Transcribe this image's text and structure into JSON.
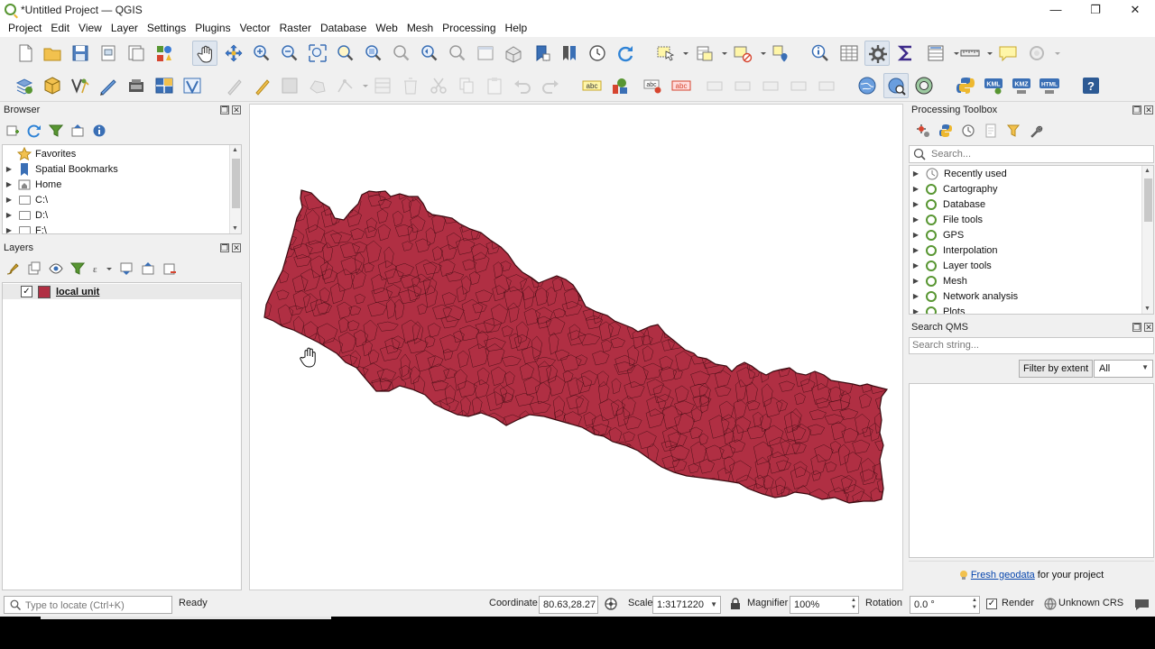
{
  "window": {
    "title": "*Untitled Project — QGIS",
    "controls": [
      "—",
      "❐",
      "✕"
    ]
  },
  "menu": [
    "Project",
    "Edit",
    "View",
    "Layer",
    "Settings",
    "Plugins",
    "Vector",
    "Raster",
    "Database",
    "Web",
    "Mesh",
    "Processing",
    "Help"
  ],
  "toolbar2_labels": {
    "abc": "abc",
    "kml": "KML",
    "kmz": "KMZ",
    "html": "HTML",
    "help": "?"
  },
  "browser": {
    "title": "Browser",
    "items": [
      {
        "label": "Favorites",
        "icon": "star-icon"
      },
      {
        "label": "Spatial Bookmarks",
        "icon": "bookmark-icon"
      },
      {
        "label": "Home",
        "icon": "home-folder-icon"
      },
      {
        "label": "C:\\",
        "icon": "folder-icon"
      },
      {
        "label": "D:\\",
        "icon": "folder-icon"
      },
      {
        "label": "F:\\",
        "icon": "folder-icon"
      }
    ]
  },
  "layers": {
    "title": "Layers",
    "items": [
      {
        "label": "local unit",
        "checked": true,
        "color": "#b02f43"
      }
    ]
  },
  "map": {
    "fill": "#b02f43",
    "stroke": "#3b0a10",
    "background": "#ffffff"
  },
  "toolbox": {
    "title": "Processing Toolbox",
    "search_placeholder": "Search...",
    "items": [
      {
        "label": "Recently used",
        "icon": "clock-icon"
      },
      {
        "label": "Cartography",
        "icon": "qgis-icon"
      },
      {
        "label": "Database",
        "icon": "qgis-icon"
      },
      {
        "label": "File tools",
        "icon": "qgis-icon"
      },
      {
        "label": "GPS",
        "icon": "qgis-icon"
      },
      {
        "label": "Interpolation",
        "icon": "qgis-icon"
      },
      {
        "label": "Layer tools",
        "icon": "qgis-icon"
      },
      {
        "label": "Mesh",
        "icon": "qgis-icon"
      },
      {
        "label": "Network analysis",
        "icon": "qgis-icon"
      },
      {
        "label": "Plots",
        "icon": "qgis-icon"
      }
    ]
  },
  "qms": {
    "title": "Search QMS",
    "search_placeholder": "Search string...",
    "filter_button": "Filter by extent",
    "filter_select": "All",
    "footer_link": "Fresh geodata",
    "footer_text": " for your project"
  },
  "status": {
    "locate_placeholder": "Type to locate (Ctrl+K)",
    "state": "Ready",
    "coordinate_label": "Coordinate",
    "coordinate_value": "80.63,28.27",
    "scale_label": "Scale",
    "scale_value": "1:3171220",
    "magnifier_label": "Magnifier",
    "magnifier_value": "100%",
    "rotation_label": "Rotation",
    "rotation_value": "0.0 °",
    "render_label": "Render",
    "render_checked": true,
    "crs_label": "Unknown CRS"
  }
}
